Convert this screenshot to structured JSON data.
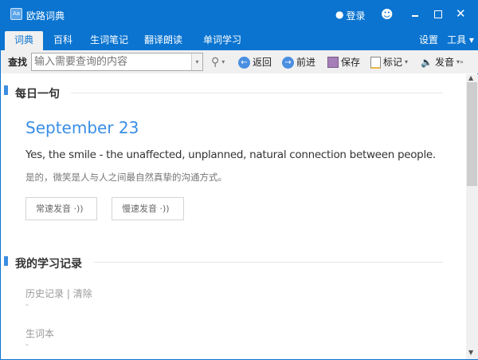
{
  "app": {
    "title": "欧路词典",
    "login": "登录"
  },
  "tabs": [
    "词典",
    "百科",
    "生词笔记",
    "翻译朗读",
    "单词学习"
  ],
  "right_menu": {
    "settings": "设置",
    "tools": "工具"
  },
  "toolbar": {
    "find_label": "查找",
    "search_placeholder": "输入需要查询的内容",
    "back": "返回",
    "forward": "前进",
    "save": "保存",
    "mark": "标记",
    "pronounce": "发音"
  },
  "daily": {
    "heading": "每日一句",
    "date": "September 23",
    "sentence_en": "Yes, the smile - the unaffected, unplanned, natural connection between people.",
    "sentence_zh": "是的，微笑是人与人之间最自然真挚的沟通方式。",
    "normal_speed": "常速发音",
    "slow_speed": "慢速发音"
  },
  "records": {
    "heading": "我的学习记录",
    "history": "历史记录",
    "separator": "|",
    "clear": "清除",
    "history_value": "-",
    "wordbook": "生词本",
    "wordbook_value": "-"
  },
  "colors": {
    "brand": "#0a74d0",
    "accent": "#3a8ee6"
  }
}
